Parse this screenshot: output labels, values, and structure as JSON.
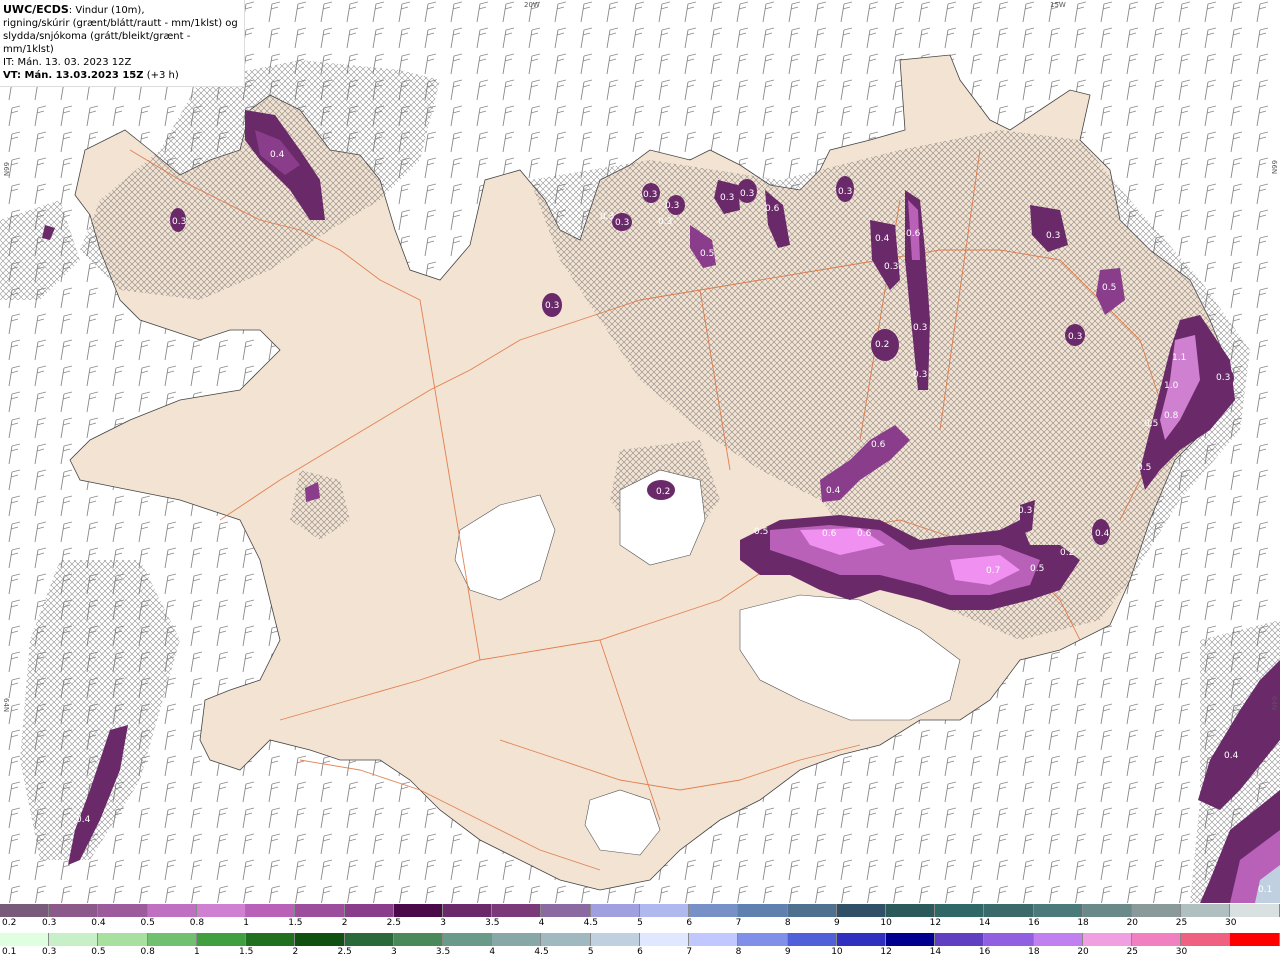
{
  "header": {
    "model": "UWC/ECDS",
    "line1_rest": ": Vindur (10m),",
    "line2": "rigning/skúrir (grænt/blátt/rautt - mm/1klst) og",
    "line3": "slydda/snjókoma (grátt/bleikt/grænt - mm/1klst)",
    "it_label": "IT:",
    "it_value": " Mán.  13. 03. 2023 12Z",
    "vt_label": "VT: Mán.  13.03.2023 15Z",
    "vt_offset": " (+3 h)"
  },
  "grid_labels": {
    "lon_20w": "20W",
    "lon_15w": "15W",
    "lat_66n_left": "66N",
    "lat_66n_right": "66N",
    "lat_64n_left": "64N",
    "lat_64n_right": "64N"
  },
  "precip_labels": [
    "0.4",
    "0.3",
    "0.3",
    "0.3",
    "0.3",
    "0.3",
    "0.3",
    "0.5",
    "0.3",
    "0.3",
    "0.3",
    "0.6",
    "0.3",
    "0.6",
    "0.4",
    "0.3",
    "0.3",
    "0.3",
    "0.2",
    "0.3",
    "0.5",
    "0.3",
    "1.1",
    "1.0",
    "0.8",
    "0.5",
    "0.5",
    "0.3",
    "0.6",
    "0.4",
    "0.2",
    "0.5",
    "0.6",
    "0.6",
    "0.7",
    "0.5",
    "0.2",
    "0.3",
    "0.4",
    "0.4",
    "0.4",
    "0.1"
  ],
  "legend_snow": {
    "labels": [
      "0.2",
      "0.3",
      "0.4",
      "0.5",
      "0.8",
      "1",
      "1.5",
      "2",
      "2.5",
      "3",
      "3.5",
      "4",
      "4.5",
      "5",
      "6",
      "7",
      "8",
      "9",
      "10",
      "12",
      "14",
      "16",
      "18",
      "20",
      "25",
      "30"
    ],
    "colors": [
      "#7a5a7a",
      "#8b5a8b",
      "#9c5c9c",
      "#c070c0",
      "#d080d0",
      "#b960b9",
      "#9c4d9c",
      "#8a3d8a",
      "#4a0a4a",
      "#6a2a6a",
      "#7a3a7a",
      "#8a6aa0",
      "#a0a0e0",
      "#b0b8f0",
      "#7890c8",
      "#6080b0",
      "#507090",
      "#305068",
      "#2a5a5a",
      "#306868",
      "#3a6a6a",
      "#4a7a7a",
      "#6a8a8a",
      "#8a9a9a",
      "#b0c0c0",
      "#d8e0e0"
    ]
  },
  "legend_rain": {
    "labels": [
      "0.1",
      "0.3",
      "0.5",
      "0.8",
      "1",
      "1.5",
      "2",
      "2.5",
      "3",
      "3.5",
      "4",
      "4.5",
      "5",
      "6",
      "7",
      "8",
      "9",
      "10",
      "12",
      "14",
      "16",
      "18",
      "20",
      "25",
      "30"
    ],
    "colors": [
      "#e0ffe0",
      "#c8f0c8",
      "#a8e0a0",
      "#70c070",
      "#40a040",
      "#207020",
      "#105010",
      "#2a6a3a",
      "#4a8a5a",
      "#6a9a8a",
      "#88a8a8",
      "#a0b8c0",
      "#c0d0e0",
      "#e0e8ff",
      "#c0c8ff",
      "#8090e8",
      "#5060d8",
      "#3030c0",
      "#000090",
      "#6040c0",
      "#9060e0",
      "#c080f0",
      "#f0a0e0",
      "#f080c0",
      "#f06080",
      "#ff0000"
    ]
  }
}
